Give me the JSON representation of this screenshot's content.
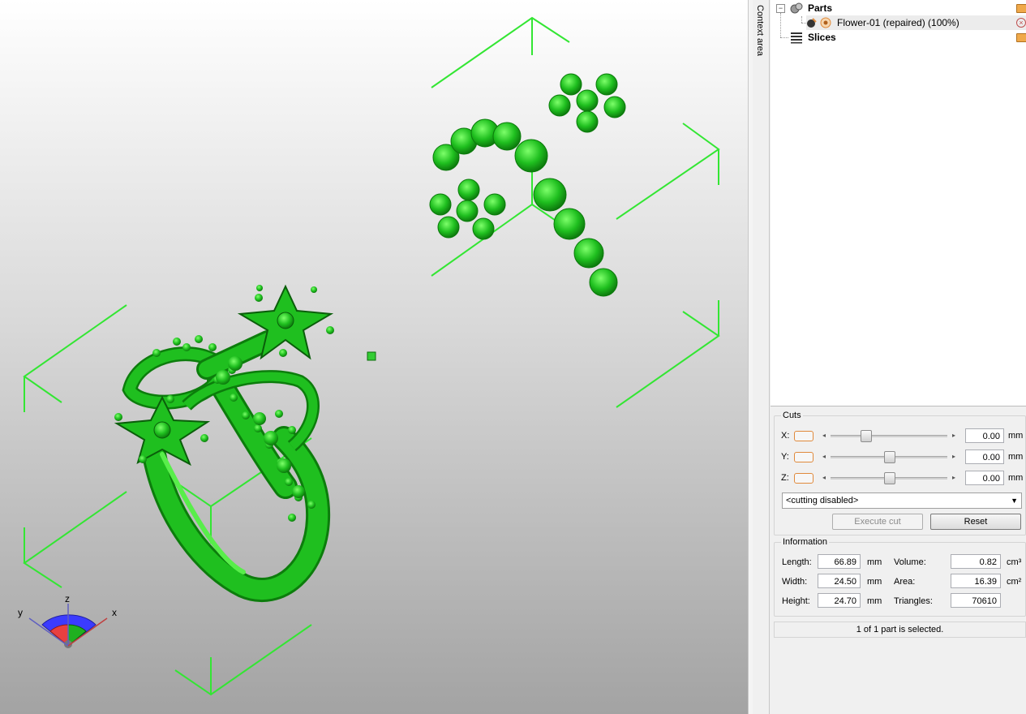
{
  "context_tab": {
    "label": "Context area"
  },
  "tree": {
    "parts": {
      "label": "Parts"
    },
    "part_item": {
      "label": "Flower-01 (repaired) (100%)"
    },
    "slices": {
      "label": "Slices"
    }
  },
  "cuts": {
    "title": "Cuts",
    "x": {
      "label": "X:",
      "value": "0.00",
      "unit": "mm",
      "slider_fraction": 0.28
    },
    "y": {
      "label": "Y:",
      "value": "0.00",
      "unit": "mm",
      "slider_fraction": 0.5
    },
    "z": {
      "label": "Z:",
      "value": "0.00",
      "unit": "mm",
      "slider_fraction": 0.5
    },
    "mode_select": {
      "value": "<cutting disabled>"
    },
    "execute_label": "Execute cut",
    "reset_label": "Reset"
  },
  "information": {
    "title": "Information",
    "length": {
      "label": "Length:",
      "value": "66.89",
      "unit": "mm"
    },
    "width": {
      "label": "Width:",
      "value": "24.50",
      "unit": "mm"
    },
    "height": {
      "label": "Height:",
      "value": "24.70",
      "unit": "mm"
    },
    "volume": {
      "label": "Volume:",
      "value": "0.82",
      "unit": "cm³"
    },
    "area": {
      "label": "Area:",
      "value": "16.39",
      "unit": "cm²"
    },
    "triangles": {
      "label": "Triangles:",
      "value": "70610"
    }
  },
  "status": {
    "text": "1 of 1 part is selected."
  },
  "axes": {
    "x": "x",
    "y": "y",
    "z": "z"
  },
  "colors": {
    "model_green": "#1fbf1f",
    "bbox_green": "#33e633",
    "accent_orange": "#e08a3c"
  }
}
